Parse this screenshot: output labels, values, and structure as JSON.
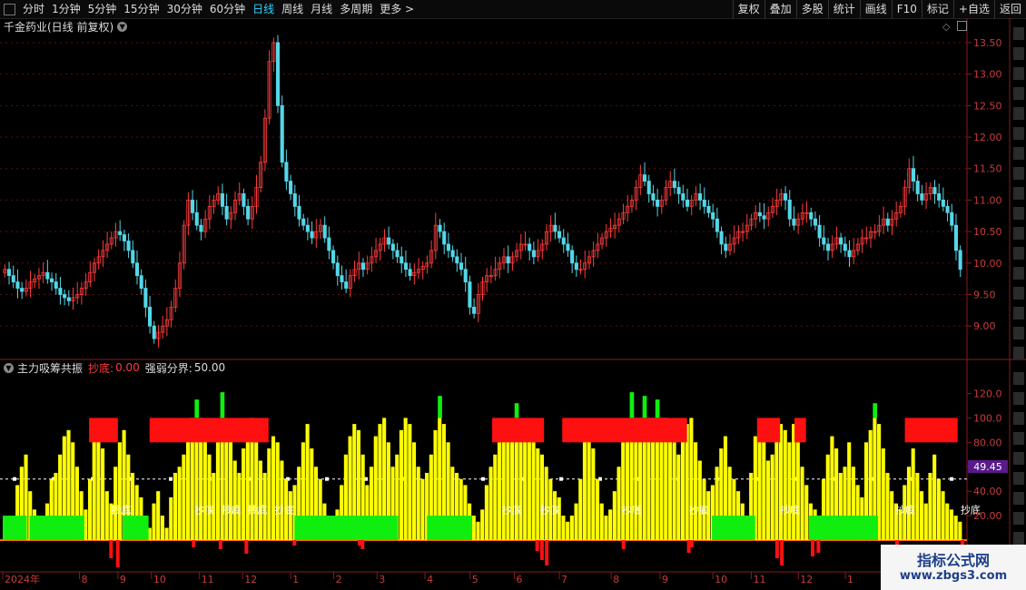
{
  "toolbar": {
    "periods": [
      "分时",
      "1分钟",
      "5分钟",
      "15分钟",
      "30分钟",
      "60分钟",
      "日线",
      "周线",
      "月线",
      "多周期",
      "更多 >"
    ],
    "active_period": "日线",
    "right_buttons": [
      "复权",
      "叠加",
      "多股",
      "统计",
      "画线",
      "F10",
      "标记",
      "+自选",
      "返回"
    ]
  },
  "main_chart": {
    "title": "千金药业(日线 前复权)",
    "price_ticks": [
      "13.50",
      "13.00",
      "12.50",
      "12.00",
      "11.50",
      "11.00",
      "10.50",
      "10.00",
      "9.50",
      "9.00"
    ]
  },
  "indicator": {
    "name": "主力吸筹共振",
    "signal_label": "抄底:",
    "signal_value": "0.00",
    "boundary_label": "强弱分界:",
    "boundary_value": "50.00",
    "ticks": [
      "120.0",
      "100.0",
      "80.00",
      "60.00",
      "40.00",
      "20.00"
    ],
    "current_marker": "49.45",
    "buy_label": "抄底"
  },
  "date_axis": {
    "labels": [
      "2024年",
      "8",
      "9",
      "10",
      "11",
      "12",
      "1",
      "2",
      "3",
      "4",
      "5",
      "6",
      "7",
      "8",
      "9",
      "10",
      "11",
      "12",
      "1"
    ]
  },
  "watermark": {
    "line1": "指标公式网",
    "line2": "www.zbgs3.com"
  },
  "colors": {
    "up": "#ff3c3c",
    "down": "#54d7e8",
    "yellow": "#ffff00",
    "green": "#10ee10",
    "red": "#ff1010",
    "active": "#29d4ff"
  },
  "chart_data": {
    "type": "candlestick",
    "price_range": [
      8.7,
      13.6
    ],
    "closes": [
      9.9,
      9.8,
      9.7,
      9.6,
      9.55,
      9.6,
      9.7,
      9.75,
      9.8,
      9.85,
      9.75,
      9.7,
      9.6,
      9.5,
      9.45,
      9.4,
      9.45,
      9.5,
      9.6,
      9.7,
      9.85,
      10.0,
      10.1,
      10.2,
      10.3,
      10.4,
      10.5,
      10.45,
      10.35,
      10.2,
      10.0,
      9.8,
      9.6,
      9.3,
      9.0,
      8.8,
      8.9,
      9.0,
      9.1,
      9.3,
      9.6,
      10.0,
      10.6,
      11.0,
      10.8,
      10.6,
      10.5,
      10.7,
      10.9,
      11.0,
      11.1,
      10.9,
      10.7,
      10.8,
      11.0,
      11.1,
      10.9,
      10.7,
      10.9,
      11.2,
      11.6,
      12.3,
      13.2,
      13.5,
      12.5,
      11.6,
      11.3,
      11.1,
      10.9,
      10.7,
      10.6,
      10.5,
      10.4,
      10.5,
      10.6,
      10.4,
      10.2,
      10.0,
      9.8,
      9.7,
      9.6,
      9.8,
      9.9,
      10.0,
      9.9,
      10.0,
      10.1,
      10.2,
      10.3,
      10.4,
      10.3,
      10.2,
      10.1,
      10.0,
      9.9,
      9.8,
      9.85,
      9.9,
      9.95,
      10.0,
      10.2,
      10.6,
      10.5,
      10.3,
      10.2,
      10.1,
      10.0,
      9.9,
      9.7,
      9.3,
      9.2,
      9.5,
      9.7,
      9.8,
      9.8,
      9.9,
      10.0,
      10.1,
      10.0,
      10.1,
      10.2,
      10.3,
      10.3,
      10.2,
      10.1,
      10.2,
      10.3,
      10.5,
      10.6,
      10.5,
      10.4,
      10.3,
      10.2,
      10.0,
      9.9,
      9.9,
      10.0,
      10.1,
      10.2,
      10.3,
      10.4,
      10.5,
      10.55,
      10.6,
      10.7,
      10.8,
      10.9,
      11.0,
      11.2,
      11.4,
      11.3,
      11.1,
      11.0,
      10.9,
      11.0,
      11.2,
      11.3,
      11.2,
      11.1,
      11.0,
      10.9,
      11.0,
      11.1,
      11.0,
      10.9,
      10.8,
      10.7,
      10.5,
      10.3,
      10.2,
      10.3,
      10.4,
      10.5,
      10.5,
      10.6,
      10.7,
      10.8,
      10.75,
      10.7,
      10.8,
      10.9,
      11.0,
      11.1,
      11.0,
      10.7,
      10.6,
      10.7,
      10.8,
      10.8,
      10.7,
      10.6,
      10.4,
      10.3,
      10.2,
      10.3,
      10.4,
      10.3,
      10.2,
      10.1,
      10.2,
      10.3,
      10.4,
      10.4,
      10.5,
      10.5,
      10.6,
      10.7,
      10.6,
      10.7,
      10.8,
      10.9,
      11.2,
      11.5,
      11.3,
      11.1,
      11.0,
      11.1,
      11.2,
      11.1,
      11.0,
      10.9,
      10.8,
      10.6,
      10.2,
      9.9
    ],
    "indicator_values": [
      15,
      12,
      18,
      45,
      60,
      70,
      40,
      25,
      20,
      15,
      30,
      50,
      55,
      70,
      85,
      90,
      80,
      60,
      40,
      25,
      50,
      88,
      95,
      75,
      40,
      30,
      60,
      80,
      90,
      70,
      55,
      45,
      35,
      20,
      10,
      30,
      40,
      20,
      10,
      35,
      55,
      60,
      70,
      95,
      100,
      100,
      100,
      85,
      70,
      55,
      80,
      100,
      95,
      85,
      65,
      55,
      75,
      90,
      100,
      80,
      65,
      55,
      75,
      85,
      80,
      65,
      50,
      40,
      45,
      60,
      80,
      95,
      75,
      60,
      50,
      30,
      15,
      10,
      25,
      45,
      70,
      85,
      95,
      90,
      70,
      45,
      60,
      85,
      95,
      100,
      80,
      60,
      70,
      90,
      100,
      95,
      80,
      60,
      50,
      55,
      70,
      90,
      100,
      95,
      80,
      60,
      55,
      50,
      45,
      30,
      20,
      15,
      25,
      45,
      60,
      70,
      80,
      85,
      90,
      95,
      100,
      95,
      90,
      85,
      80,
      75,
      70,
      60,
      50,
      40,
      35,
      20,
      15,
      20,
      30,
      50,
      85,
      90,
      75,
      50,
      30,
      20,
      25,
      40,
      60,
      80,
      95,
      100,
      100,
      100,
      100,
      100,
      100,
      100,
      100,
      100,
      90,
      80,
      70,
      85,
      95,
      100,
      80,
      65,
      50,
      40,
      45,
      60,
      75,
      85,
      60,
      50,
      40,
      30,
      20,
      55,
      85,
      95,
      80,
      65,
      70,
      85,
      95,
      90,
      80,
      95,
      80,
      60,
      45,
      30,
      25,
      20,
      50,
      70,
      85,
      75,
      55,
      60,
      80,
      60,
      45,
      35,
      80,
      90,
      100,
      95,
      75,
      55,
      40,
      30,
      25,
      45,
      60,
      75,
      55,
      40,
      30,
      55,
      70,
      50,
      40,
      30,
      25,
      20,
      15
    ],
    "boundary": 50
  }
}
